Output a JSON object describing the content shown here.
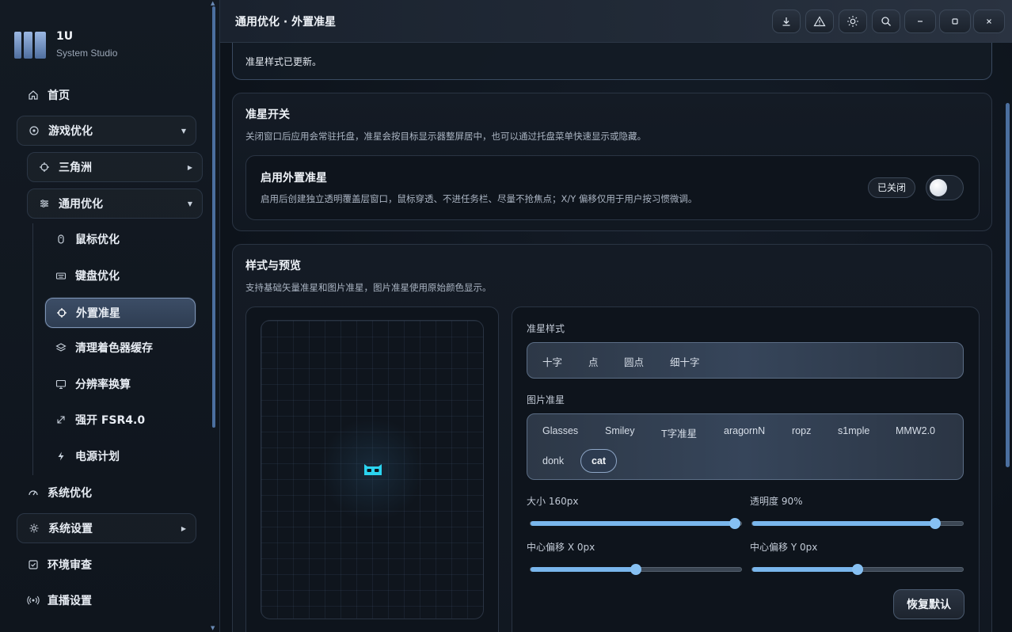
{
  "brand": {
    "title": "1U",
    "subtitle": "System Studio"
  },
  "sidebar": {
    "items": [
      {
        "label": "首页",
        "icon": "home-icon"
      },
      {
        "label": "游戏优化",
        "icon": "crosshair-circle-icon"
      },
      {
        "label": "三角洲",
        "icon": "target-icon"
      },
      {
        "label": "通用优化",
        "icon": "sliders-icon"
      },
      {
        "label": "鼠标优化",
        "icon": "mouse-icon"
      },
      {
        "label": "键盘优化",
        "icon": "keyboard-icon"
      },
      {
        "label": "外置准星",
        "icon": "crosshair-icon"
      },
      {
        "label": "清理着色器缓存",
        "icon": "layers-icon"
      },
      {
        "label": "分辨率换算",
        "icon": "monitor-icon"
      },
      {
        "label": "强开 FSR4.0",
        "icon": "expand-arrow-icon"
      },
      {
        "label": "电源计划",
        "icon": "bolt-icon"
      },
      {
        "label": "系统优化",
        "icon": "gauge-icon"
      },
      {
        "label": "系统设置",
        "icon": "gear-icon"
      },
      {
        "label": "环境审查",
        "icon": "checkbox-icon"
      },
      {
        "label": "直播设置",
        "icon": "broadcast-icon"
      }
    ]
  },
  "header": {
    "title": "通用优化 · 外置准星"
  },
  "toolbar": [
    "download-icon",
    "warning-icon",
    "sun-icon",
    "search-icon",
    "minimize-icon",
    "maximize-icon",
    "close-icon"
  ],
  "notice": {
    "text": "准星样式已更新。"
  },
  "toggle_card": {
    "title": "准星开关",
    "desc": "关闭窗口后应用会常驻托盘，准星会按目标显示器整屏居中，也可以通过托盘菜单快速显示或隐藏。",
    "option_title": "启用外置准星",
    "option_desc": "启用后创建独立透明覆盖层窗口，鼠标穿透、不进任务栏、尽量不抢焦点；X/Y 偏移仅用于用户按习惯微调。",
    "status": "已关闭",
    "enabled": false
  },
  "style_card": {
    "title": "样式与预览",
    "desc": "支持基础矢量准星和图片准星，图片准星使用原始颜色显示。",
    "style_label": "准星样式",
    "styles": [
      "十字",
      "点",
      "圆点",
      "细十字"
    ],
    "image_label": "图片准星",
    "images": [
      "Glasses",
      "Smiley",
      "T字准星",
      "aragornN",
      "ropz",
      "s1mple",
      "MMW2.0",
      "donk",
      "cat"
    ],
    "selected_image": "cat",
    "size_label": "大小 160px",
    "opacity_label": "透明度 90%",
    "offset_x_label": "中心偏移 X 0px",
    "offset_y_label": "中心偏移 Y 0px",
    "size_level": 0.97,
    "opacity_level": 0.87,
    "offset_x_level": 0.5,
    "offset_y_level": 0.5,
    "reset_label": "恢复默认",
    "preview_color": "#2bd4f0"
  },
  "colors": {
    "accent": "#79b6ec",
    "active_border": "#7e95b6"
  }
}
